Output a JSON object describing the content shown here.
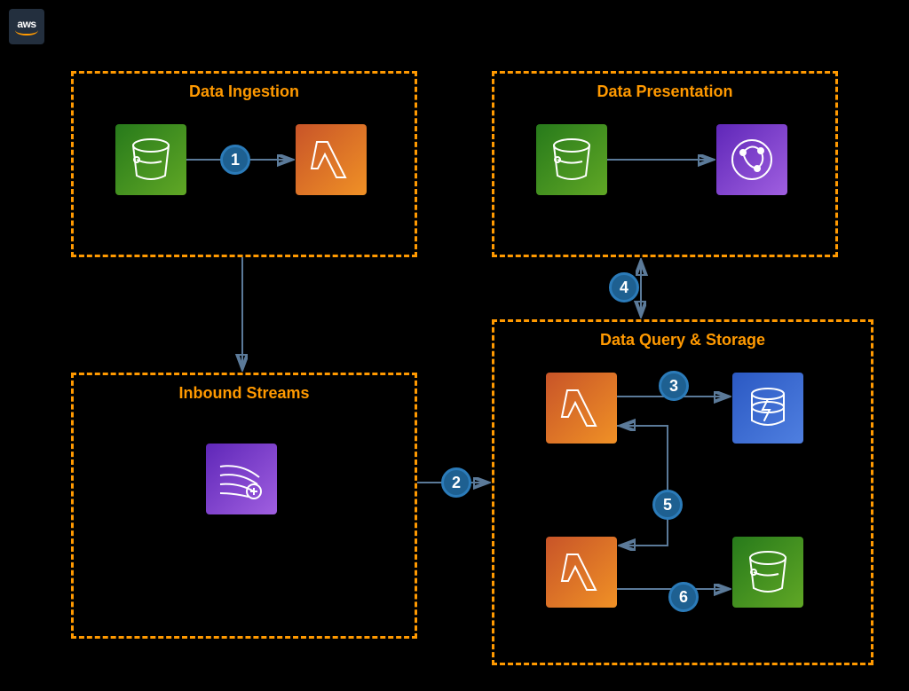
{
  "logo": {
    "text": "aws"
  },
  "groups": {
    "ingestion": {
      "title": "Data Ingestion"
    },
    "presentation": {
      "title": "Data Presentation"
    },
    "inbound": {
      "title": "Inbound Streams"
    },
    "query": {
      "title": "Data Query & Storage"
    }
  },
  "badges": {
    "b1": "1",
    "b2": "2",
    "b3": "3",
    "b4": "4",
    "b5": "5",
    "b6": "6"
  },
  "colors": {
    "accent": "#ff9900",
    "edge": "#5b7a99",
    "badgeFill": "#1e6091",
    "badgeRing": "#2b7bb9"
  }
}
